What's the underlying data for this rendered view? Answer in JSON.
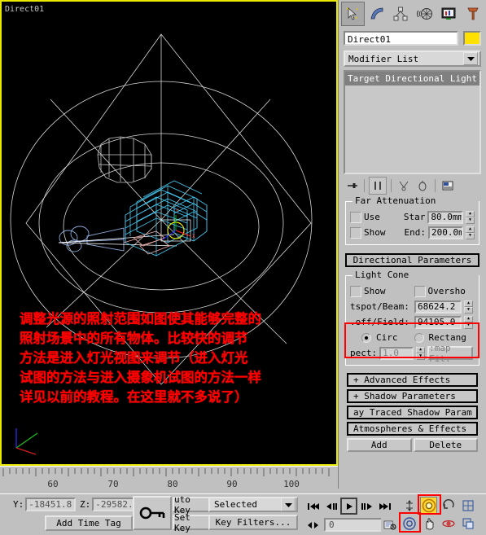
{
  "viewport": {
    "label": "Direct01",
    "annotation": "调整光源的照射范围如图使其能够完整的\n照射场景中的所有物体。比较快的调节\n方法是进入灯光视图来调节（进入灯光\n试图的方法与进入摄象机试图的方法一样\n详见以前的教程。在这里就不多说了）",
    "annotation_color": "#ff0000",
    "border_color": "#e8e800",
    "background": "#000000"
  },
  "command_panel": {
    "tabs": [
      {
        "name": "create-tab",
        "icon": "arrow-star-icon",
        "selected": true
      },
      {
        "name": "modify-tab",
        "icon": "bent-bar-icon",
        "selected": false
      },
      {
        "name": "hierarchy-tab",
        "icon": "hierarchy-tree-icon",
        "selected": false
      },
      {
        "name": "motion-tab",
        "icon": "motion-wheel-icon",
        "selected": false
      },
      {
        "name": "display-tab",
        "icon": "display-monitor-icon",
        "selected": false
      },
      {
        "name": "utilities-tab",
        "icon": "hammer-icon",
        "selected": false
      }
    ],
    "object_name": "Direct01",
    "object_color": "#ffe000",
    "modifier_list_label": "Modifier List",
    "stack_items": [
      "Target Directional Light"
    ],
    "stack_tools": [
      {
        "name": "pin-stack-icon"
      },
      {
        "name": "show-end-result-icon",
        "active": true
      },
      {
        "name": "make-unique-icon"
      },
      {
        "name": "remove-modifier-icon"
      },
      {
        "name": "configure-modifier-sets-icon"
      }
    ],
    "far_attenuation": {
      "title": "Far Attenuation",
      "use_label": "Use",
      "use_checked": false,
      "show_label": "Show",
      "show_checked": false,
      "start_label": "Star",
      "start_value": "80.0mm",
      "end_label": "End:",
      "end_value": "200.0m"
    },
    "directional_parameters": {
      "title": "Directional Parameters",
      "light_cone_title": "Light Cone",
      "show_cone_label": "Show",
      "show_cone_checked": false,
      "overshoot_label": "Oversho",
      "overshoot_checked": false,
      "hotspot_label": "tspot/Beam:",
      "hotspot_value": "68624.2",
      "falloff_label": ".off/Field:",
      "falloff_value": "94105.0",
      "circle_label": "Circ",
      "circle_selected": true,
      "rectangle_label": "Rectang",
      "rectangle_selected": false,
      "aspect_label": "pect:",
      "aspect_value": "1.0",
      "bitmap_fit_label": ":map Fit.",
      "highlight_color": "#ff0000"
    },
    "rollouts": [
      {
        "label": "+  Advanced Effects",
        "style": "outline"
      },
      {
        "label": "+  Shadow Parameters",
        "style": "outline"
      },
      {
        "label": "ay Traced Shadow Param",
        "style": "outline"
      },
      {
        "label": "Atmospheres & Effects",
        "style": "outline"
      }
    ],
    "atmos_buttons": {
      "add": "Add",
      "delete": "Delete"
    }
  },
  "timeline": {
    "tick_labels": [
      "60",
      "70",
      "80",
      "90",
      "100"
    ]
  },
  "status_bar": {
    "y_label": "Y:",
    "y_value": "-18451.8",
    "z_label": "Z:",
    "z_value": "-29582.",
    "add_time_tag": "Add Time Tag",
    "key_mode_icon": "key-icon",
    "auto_key_label": "uto Key",
    "set_key_label": "Set Key",
    "selection_set": "Selected",
    "key_filters_label": "Key Filters...",
    "current_frame": "0",
    "transport": [
      {
        "name": "goto-start-button",
        "icon": "skip-back-icon"
      },
      {
        "name": "previous-frame-button",
        "icon": "step-back-icon"
      },
      {
        "name": "play-button",
        "icon": "play-icon",
        "active": true
      },
      {
        "name": "next-frame-button",
        "icon": "step-forward-icon"
      },
      {
        "name": "goto-end-button",
        "icon": "skip-forward-icon"
      }
    ],
    "nav_top": [
      {
        "name": "zoom-button",
        "icon": "magnify-icon"
      },
      {
        "name": "zoom-all-button",
        "icon": "zoom-all-icon",
        "active": true
      },
      {
        "name": "arc-rotate-button",
        "icon": "arc-rotate-icon"
      },
      {
        "name": "min-max-toggle-button",
        "icon": "maximize-viewport-icon"
      }
    ],
    "nav_bottom": [
      {
        "name": "zoom-extents-button",
        "icon": "zoom-extents-icon",
        "highlighted": true
      },
      {
        "name": "pan-button",
        "icon": "hand-icon"
      },
      {
        "name": "field-of-view-button",
        "icon": "fov-icon"
      },
      {
        "name": "region-zoom-button",
        "icon": "region-zoom-icon"
      }
    ],
    "key_mode_toggle_icon": "key-mode-toggle-icon",
    "time-config-icon": "time-configuration-icon",
    "highlight_color": "#ff0000"
  }
}
